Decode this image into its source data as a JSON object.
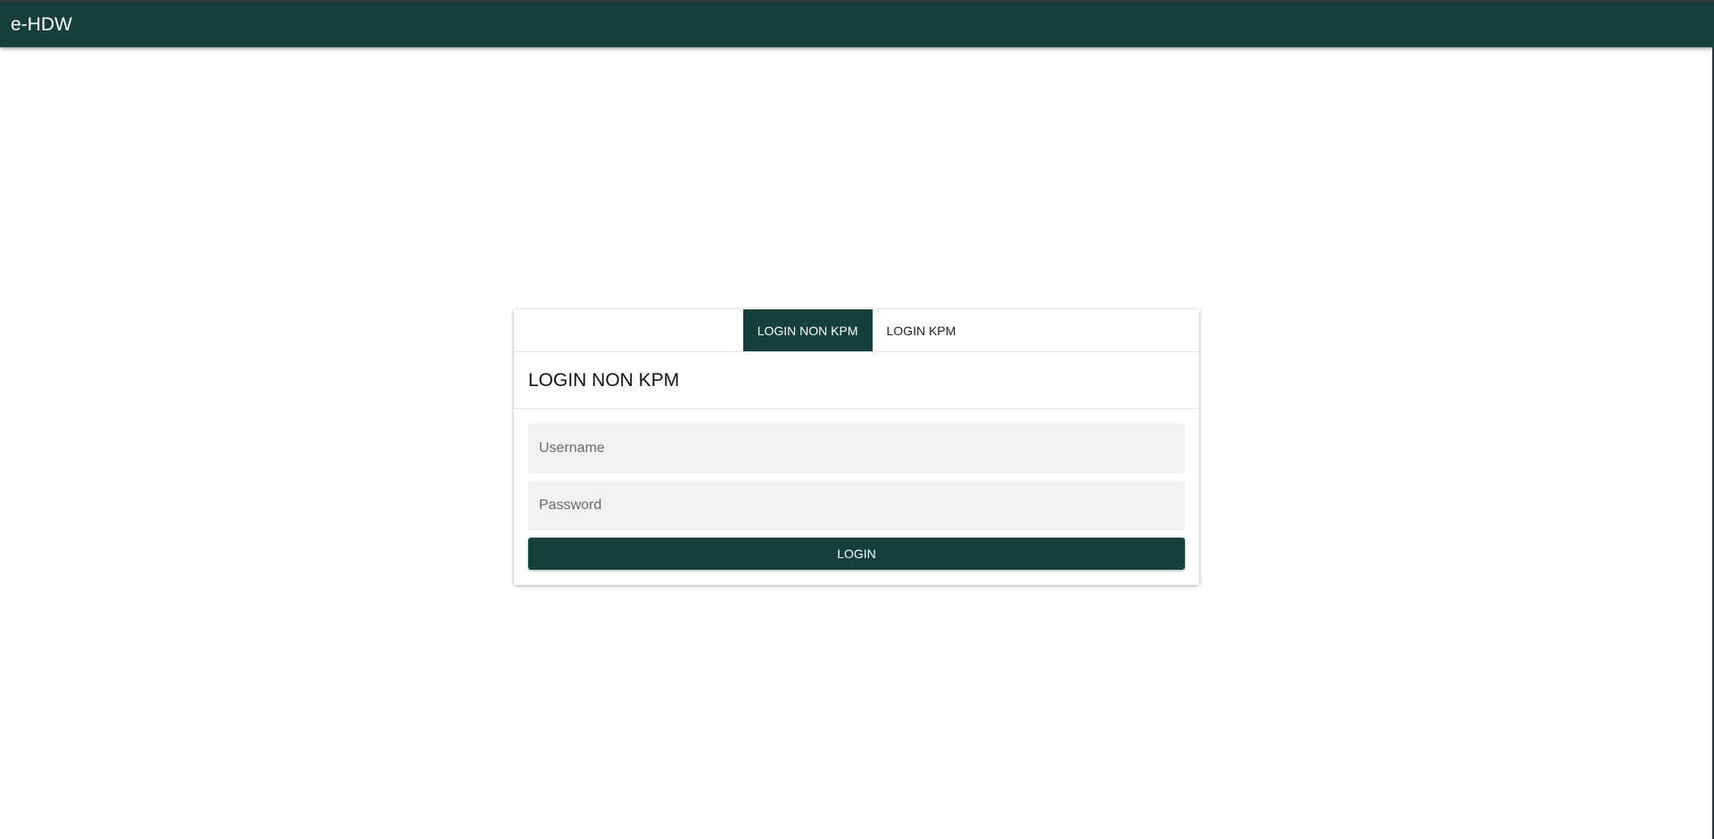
{
  "app": {
    "title": "e-HDW"
  },
  "tabs": [
    {
      "label": "LOGIN NON KPM",
      "active": true
    },
    {
      "label": "LOGIN KPM",
      "active": false
    }
  ],
  "card": {
    "title": "LOGIN NON KPM"
  },
  "form": {
    "username_placeholder": "Username",
    "username_value": "",
    "password_placeholder": "Password",
    "password_value": "",
    "submit_label": "LOGIN"
  },
  "colors": {
    "primary": "#15403b",
    "field_bg": "#f1f1f1"
  }
}
